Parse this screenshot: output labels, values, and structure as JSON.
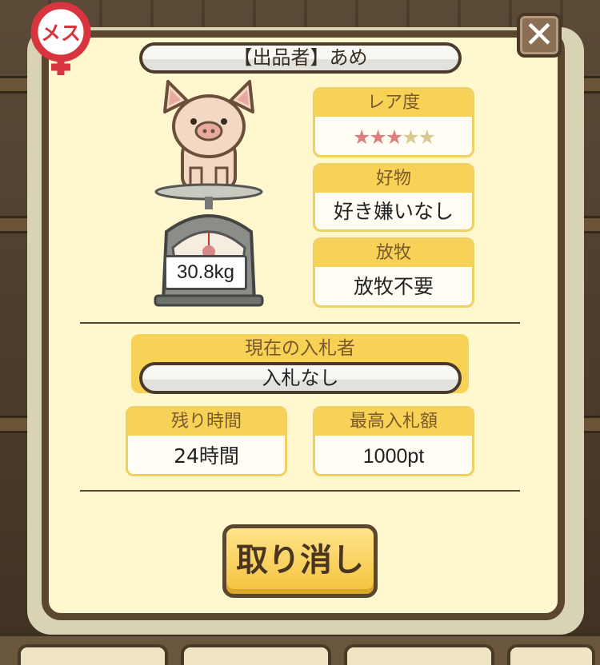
{
  "dialog": {
    "gender_badge": "メス",
    "seller": "【出品者】あめ",
    "weight": "30.8kg",
    "rarity": {
      "label": "レア度",
      "stars_filled": 3,
      "stars_total": 5,
      "star_char": "★"
    },
    "favorite": {
      "label": "好物",
      "value": "好き嫌いなし"
    },
    "grazing": {
      "label": "放牧",
      "value": "放牧不要"
    },
    "current_bidder": {
      "label": "現在の入札者",
      "value": "入札なし"
    },
    "time_left": {
      "label": "残り時間",
      "value": "24時間"
    },
    "highest_bid": {
      "label": "最高入札額",
      "value": "1000pt"
    },
    "cancel_label": "取り消し",
    "close_label": "✕"
  },
  "colors": {
    "frame": "#5b4630",
    "panel": "#fff8cf",
    "card_header": "#f7d257",
    "star_on": "#e07d7d",
    "star_off": "#d7c98f",
    "badge_red": "#d8343f"
  }
}
